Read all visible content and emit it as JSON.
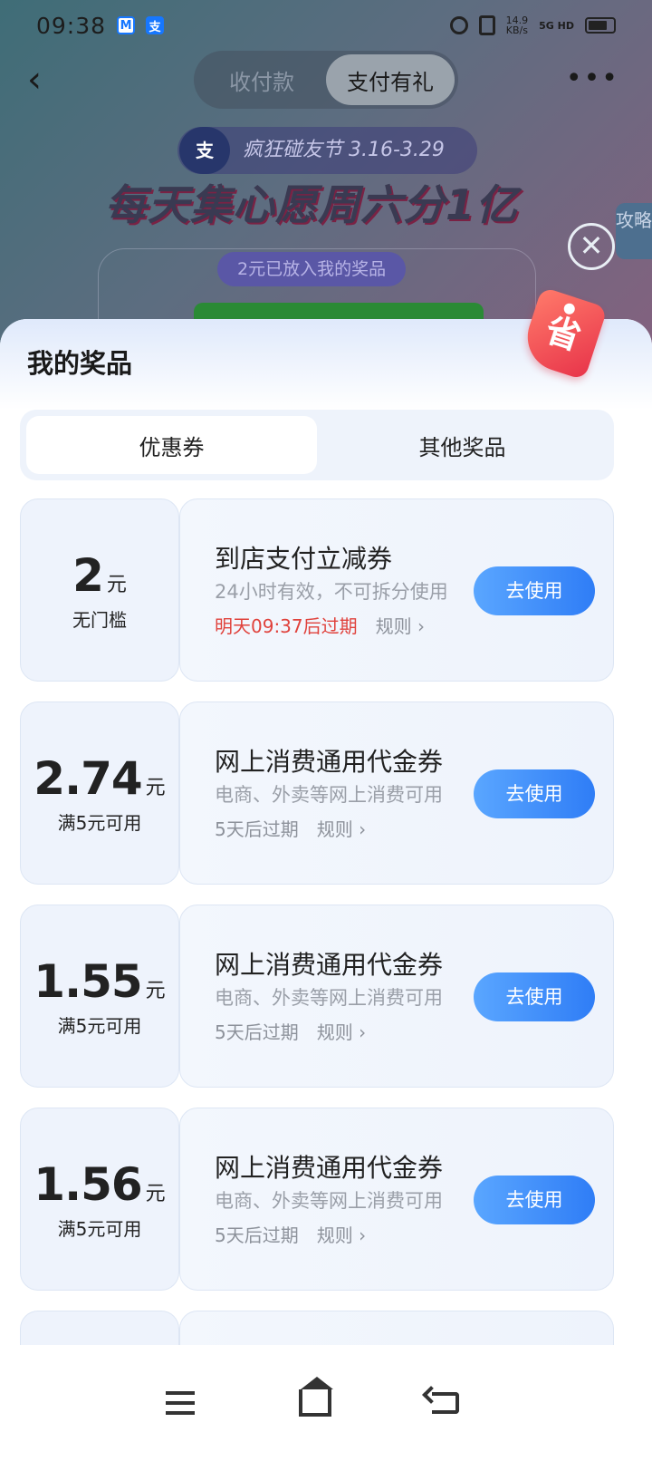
{
  "status_bar": {
    "time": "09:38",
    "net_speed": "14.9",
    "net_speed_unit": "KB/s",
    "network": "5G HD"
  },
  "nav": {
    "back_glyph": "‹",
    "tabs": [
      "收付款",
      "支付有礼"
    ],
    "active_tab": "支付有礼",
    "more_glyph": "•••"
  },
  "promo": {
    "logo": "支",
    "tag": "疯狂碰友节 3.16-3.29",
    "headline": "每天集心愿周六分1亿",
    "side_tag": "攻略",
    "prize_note": "2元已放入我的奖品"
  },
  "sheet": {
    "title": "我的奖品",
    "badge": "省",
    "tabs": [
      "优惠券",
      "其他奖品"
    ],
    "active_tab": "优惠券"
  },
  "coupons": [
    {
      "amount": "2",
      "unit": "元",
      "condition": "无门槛",
      "title": "到店支付立减券",
      "desc": "24小时有效，不可拆分使用",
      "expire": "明天09:37后过期",
      "rule": "规则 ›",
      "button": "去使用"
    },
    {
      "amount": "2.74",
      "unit": "元",
      "condition": "满5元可用",
      "title": "网上消费通用代金券",
      "desc": "电商、外卖等网上消费可用",
      "expire": "5天后过期",
      "rule": "规则 ›",
      "button": "去使用"
    },
    {
      "amount": "1.55",
      "unit": "元",
      "condition": "满5元可用",
      "title": "网上消费通用代金券",
      "desc": "电商、外卖等网上消费可用",
      "expire": "5天后过期",
      "rule": "规则 ›",
      "button": "去使用"
    },
    {
      "amount": "1.56",
      "unit": "元",
      "condition": "满5元可用",
      "title": "网上消费通用代金券",
      "desc": "电商、外卖等网上消费可用",
      "expire": "5天后过期",
      "rule": "规则 ›",
      "button": "去使用"
    }
  ],
  "colors": {
    "accent": "#2f7df6",
    "expire_warning": "#e0423c",
    "badge": "#e8344a"
  },
  "icons": {
    "close": "close-icon",
    "menu": "menu-icon",
    "home": "home-icon",
    "back": "back-icon"
  }
}
